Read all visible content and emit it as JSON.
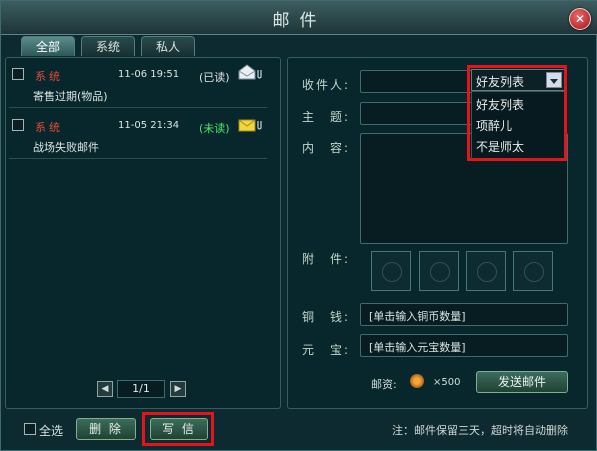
{
  "window": {
    "title": "邮件"
  },
  "tabs": [
    {
      "label": "全部",
      "active": true
    },
    {
      "label": "系统",
      "active": false
    },
    {
      "label": "私人",
      "active": false
    }
  ],
  "mail_list": [
    {
      "sender": "系统",
      "time": "11-06 19:51",
      "status": "(已读)",
      "subject": "寄售过期(物品)",
      "icon": "opened-envelope-icon",
      "status_color": "#dbe5e2"
    },
    {
      "sender": "系统",
      "time": "11-05 21:34",
      "status": "(未读)",
      "subject": "战场失败邮件",
      "icon": "closed-envelope-icon",
      "status_color": "#4fe56c"
    }
  ],
  "pagination": {
    "text": "1/1"
  },
  "compose": {
    "recipient_label": "收件人:",
    "subject_label": "主　题:",
    "content_label": "内　容:",
    "attachment_label": "附　件:",
    "copper_label": "铜　钱:",
    "copper_placeholder": "[单击输入铜币数量]",
    "gold_label": "元　宝:",
    "gold_placeholder": "[单击输入元宝数量]",
    "postage_label": "邮资:",
    "postage_value": "×500",
    "send_button": "发送邮件"
  },
  "friend_dropdown": {
    "selected": "好友列表",
    "options": [
      "好友列表",
      "项醉儿",
      "不是师太"
    ]
  },
  "footer": {
    "select_all": "全选",
    "delete_button": "删 除",
    "write_button": "写 信",
    "note": "注：邮件保留三天，超时将自动删除"
  },
  "colors": {
    "highlight": "#e3151a",
    "system_sender": "#e34b3a",
    "unread": "#4fe56c"
  }
}
